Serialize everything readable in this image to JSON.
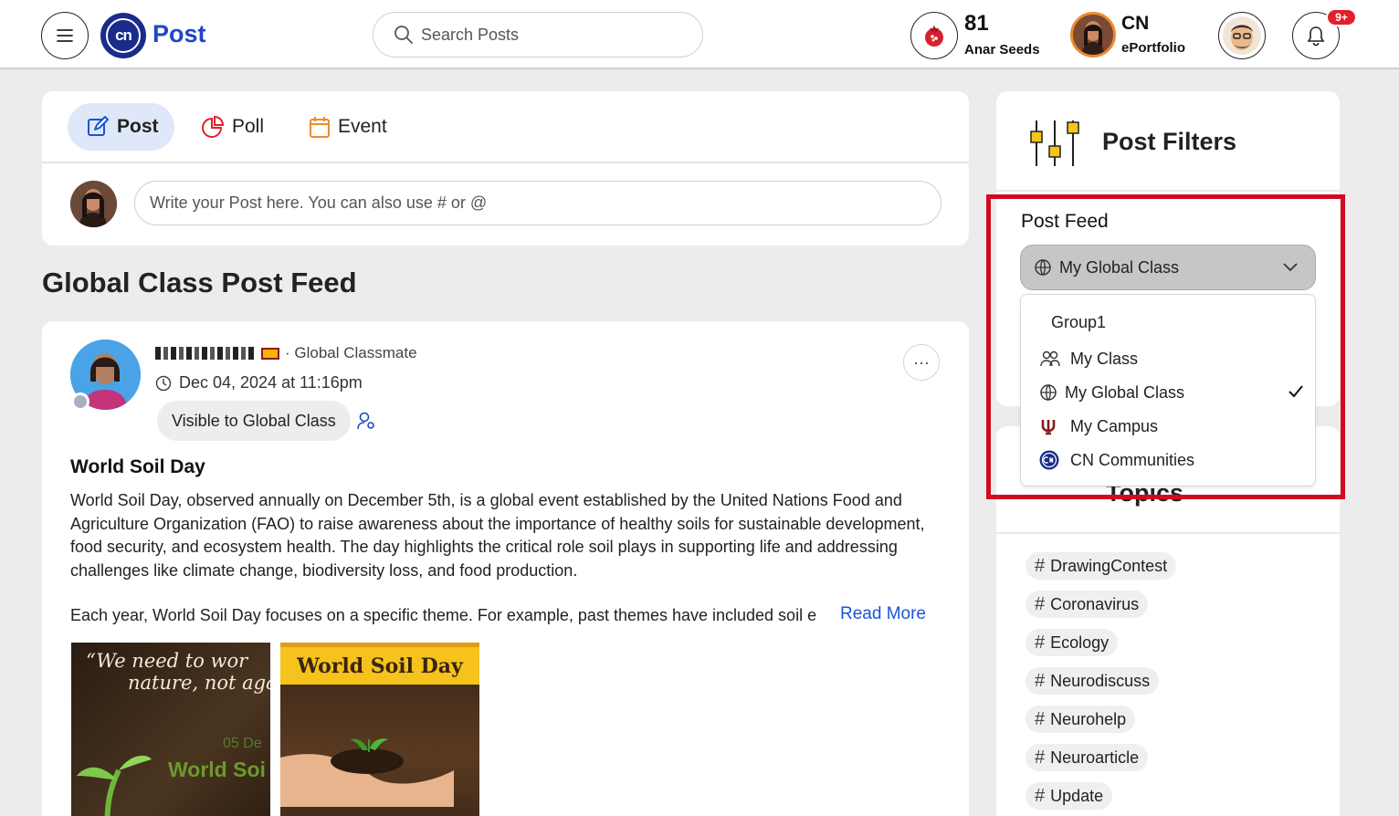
{
  "header": {
    "app_name": "Post",
    "logo_text": "cn",
    "search_placeholder": "Search Posts",
    "seeds_count": "81",
    "seeds_label": "Anar Seeds",
    "portfolio_title": "CN",
    "portfolio_label": "ePortfolio",
    "notification_badge": "9+"
  },
  "composer": {
    "tabs": [
      {
        "label": "Post",
        "active": true
      },
      {
        "label": "Poll",
        "active": false
      },
      {
        "label": "Event",
        "active": false
      }
    ],
    "input_placeholder": "Write your Post here. You can also use # or @"
  },
  "feed": {
    "title": "Global Class Post Feed"
  },
  "post": {
    "author_role": "Global Classmate",
    "timestamp": "Dec 04, 2024 at 11:16pm",
    "visibility": "Visible to Global Class",
    "more": "···",
    "title": "World Soil Day",
    "body": "World Soil Day, observed annually on December 5th, is a global event established by the United Nations Food and Agriculture Organization (FAO) to raise awareness about the importance of healthy soils for sustainable development, food security, and ecosystem health. The day highlights the critical role soil plays in supporting life and addressing challenges like climate change, biodiversity loss, and food production.",
    "body2": "Each year, World Soil Day focuses on a specific theme. For example, past themes have included soil e",
    "read_more": "Read More",
    "image1": {
      "quote_line1": "“We need to wor",
      "quote_line2": "nature, not agai",
      "date": "05 De",
      "text": "World Soi"
    },
    "image2": {
      "banner": "World Soil Day"
    }
  },
  "filters": {
    "title": "Post Filters",
    "feed_label": "Post Feed",
    "selected": "My Global Class",
    "dropdown": {
      "group_label": "Group1",
      "options": [
        {
          "label": "My Class",
          "icon": "users-icon",
          "selected": false
        },
        {
          "label": "My Global Class",
          "icon": "globe-icon",
          "selected": true
        },
        {
          "label": "My Campus",
          "icon": "campus-icon",
          "selected": false
        },
        {
          "label": "CN Communities",
          "icon": "cn-logo-icon",
          "selected": false
        }
      ]
    }
  },
  "topics": {
    "title": "Topics",
    "items": [
      "DrawingContest",
      "Coronavirus",
      "Ecology",
      "Neurodiscuss",
      "Neurohelp",
      "Neuroarticle",
      "Update"
    ]
  },
  "colors": {
    "brand_blue": "#2146c7",
    "highlight_red": "#d20a1f",
    "link_blue": "#1a55d4",
    "badge_red": "#e0212b"
  }
}
